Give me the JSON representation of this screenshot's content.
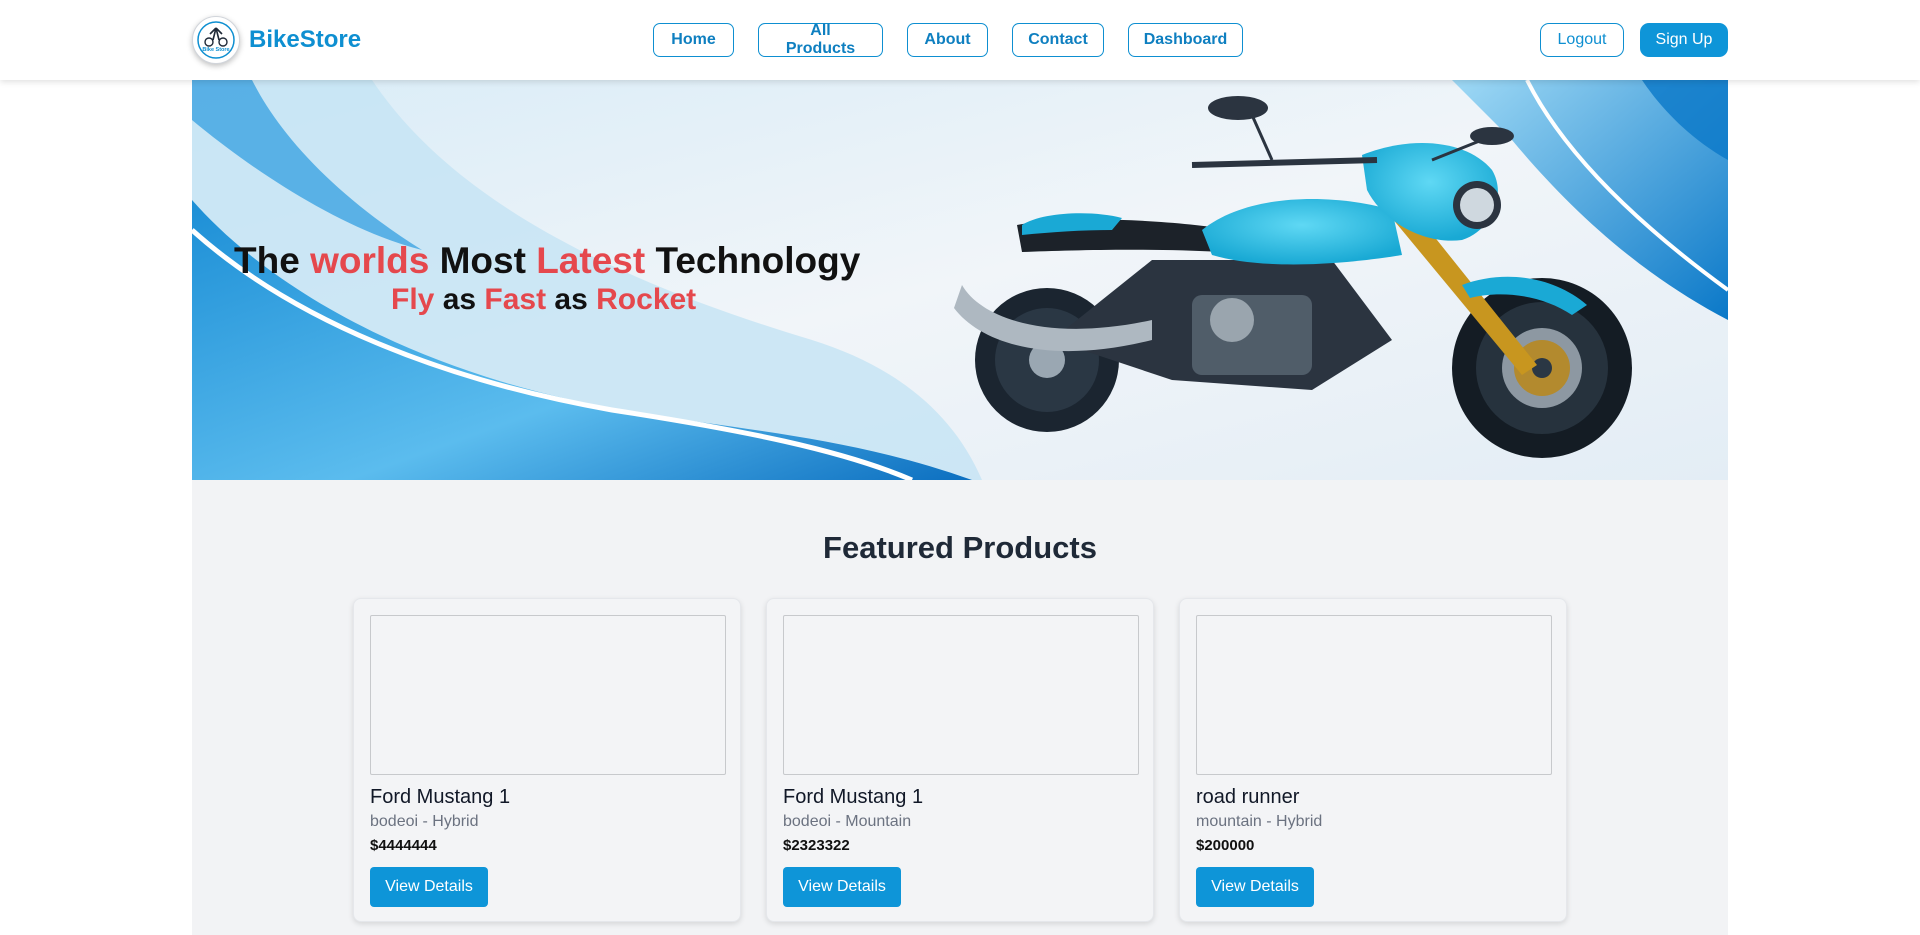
{
  "header": {
    "brand": "BikeStore",
    "logo_text": "Bike Store",
    "nav": [
      "Home",
      "All Products",
      "About",
      "Contact",
      "Dashboard"
    ],
    "logout_label": "Logout",
    "signup_label": "Sign Up"
  },
  "hero": {
    "title_parts": [
      "The ",
      "worlds",
      " Most ",
      "Latest",
      " Technology"
    ],
    "subtitle_parts": [
      "Fly",
      " as ",
      "Fast",
      " as ",
      "Rocket"
    ],
    "accent_color": "#e5484d"
  },
  "featured": {
    "title": "Featured Products",
    "products": [
      {
        "name": "Ford Mustang 1",
        "meta": "bodeoi - Hybrid",
        "price": "$4444444",
        "button": "View Details"
      },
      {
        "name": "Ford Mustang 1",
        "meta": "bodeoi - Mountain",
        "price": "$2323322",
        "button": "View Details"
      },
      {
        "name": "road runner",
        "meta": "mountain - Hybrid",
        "price": "$200000",
        "button": "View Details"
      }
    ]
  },
  "colors": {
    "brand": "#0e8fd1",
    "button": "#0e95d8"
  }
}
